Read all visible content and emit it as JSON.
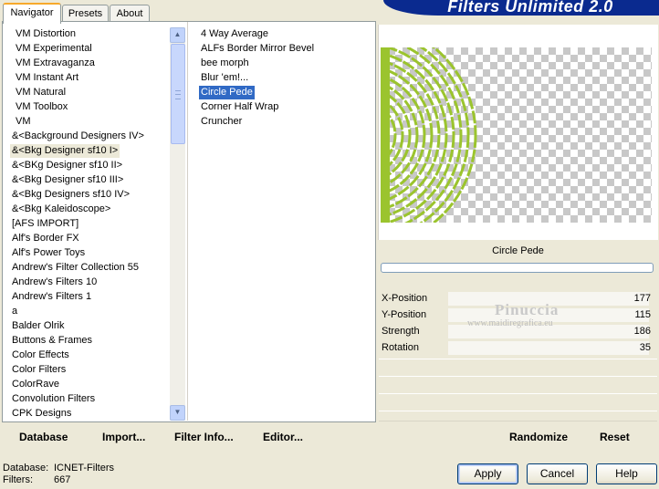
{
  "app": {
    "title": "Filters Unlimited 2.0"
  },
  "tabs": [
    {
      "label": "Navigator",
      "active": true
    },
    {
      "label": "Presets",
      "active": false
    },
    {
      "label": "About",
      "active": false
    }
  ],
  "categories": {
    "items": [
      "VM Distortion",
      "VM Experimental",
      "VM Extravaganza",
      "VM Instant Art",
      "VM Natural",
      "VM Toolbox",
      "VM",
      "&<Background Designers IV>",
      "&<Bkg Designer sf10 I>",
      "&<BKg Designer sf10 II>",
      "&<Bkg Designer sf10 III>",
      "&<Bkg Designers sf10 IV>",
      "&<Bkg Kaleidoscope>",
      "[AFS IMPORT]",
      "Alf's Border FX",
      "Alf's Power Toys",
      "Andrew's Filter Collection 55",
      "Andrew's Filters 10",
      "Andrew's Filters 1",
      "a",
      "Balder Olrik",
      "Buttons & Frames",
      "Color Effects",
      "Color Filters",
      "ColorRave",
      "Convolution Filters",
      "CPK Designs"
    ],
    "selected": "&<Bkg Designer sf10 I>"
  },
  "filters": {
    "items": [
      "4 Way Average",
      "ALFs Border Mirror Bevel",
      "bee morph",
      "Blur 'em!...",
      "Circle Pede",
      "Corner Half Wrap",
      "Cruncher"
    ],
    "selected": "Circle Pede"
  },
  "left_buttons": {
    "database": "Database",
    "import": "Import...",
    "filter_info": "Filter Info...",
    "editor": "Editor..."
  },
  "preview": {
    "filter_name": "Circle Pede",
    "accent_color": "#9bc42e",
    "progress": 0
  },
  "parameters": [
    {
      "name": "X-Position",
      "value": "177"
    },
    {
      "name": "Y-Position",
      "value": "115"
    },
    {
      "name": "Strength",
      "value": "186"
    },
    {
      "name": "Rotation",
      "value": "35"
    }
  ],
  "right_buttons": {
    "randomize": "Randomize",
    "reset": "Reset"
  },
  "watermark": {
    "name": "Pinuccia",
    "site": "www.maidiregrafica.eu"
  },
  "status": {
    "database_label": "Database:",
    "database_value": "ICNET-Filters",
    "filters_label": "Filters:",
    "filters_value": "667"
  },
  "dialog_buttons": {
    "apply": "Apply",
    "cancel": "Cancel",
    "help": "Help"
  },
  "icons": {
    "scroll_up": "scroll-up-arrow-icon",
    "scroll_down": "scroll-down-arrow-icon"
  }
}
